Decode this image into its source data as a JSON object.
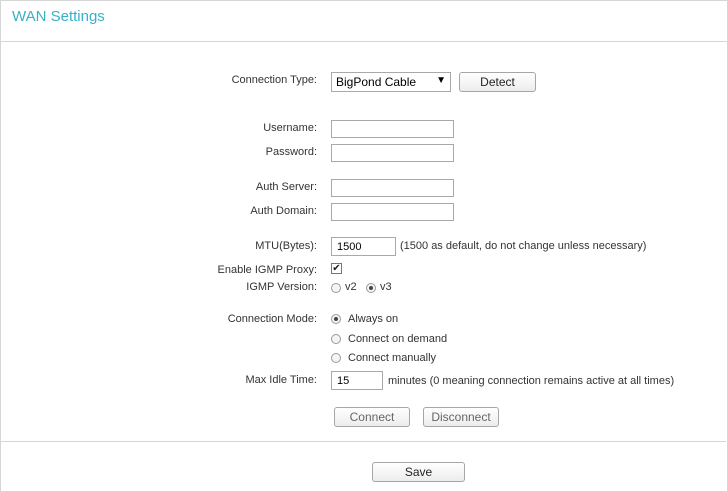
{
  "page": {
    "title": "WAN Settings"
  },
  "form": {
    "connection_type": {
      "label": "Connection Type:",
      "value": "BigPond Cable",
      "detect_label": "Detect"
    },
    "username": {
      "label": "Username:",
      "value": ""
    },
    "password": {
      "label": "Password:",
      "value": ""
    },
    "auth_server": {
      "label": "Auth Server:",
      "value": ""
    },
    "auth_domain": {
      "label": "Auth Domain:",
      "value": ""
    },
    "mtu": {
      "label": "MTU(Bytes):",
      "value": "1500",
      "hint": "(1500 as default, do not change unless necessary)"
    },
    "igmp_proxy": {
      "label": "Enable IGMP Proxy:",
      "checked": true
    },
    "igmp_version": {
      "label": "IGMP Version:",
      "options": [
        "v2",
        "v3"
      ],
      "selected": "v3"
    },
    "connection_mode": {
      "label": "Connection Mode:",
      "options": [
        "Always on",
        "Connect on demand",
        "Connect manually"
      ],
      "selected": "Always on"
    },
    "max_idle": {
      "label": "Max Idle Time:",
      "value": "15",
      "hint": "minutes (0 meaning connection remains active at all times)"
    },
    "connect_label": "Connect",
    "disconnect_label": "Disconnect"
  },
  "footer": {
    "save_label": "Save"
  },
  "colors": {
    "title": "#37b1c9",
    "border": "#d6d6d6"
  }
}
